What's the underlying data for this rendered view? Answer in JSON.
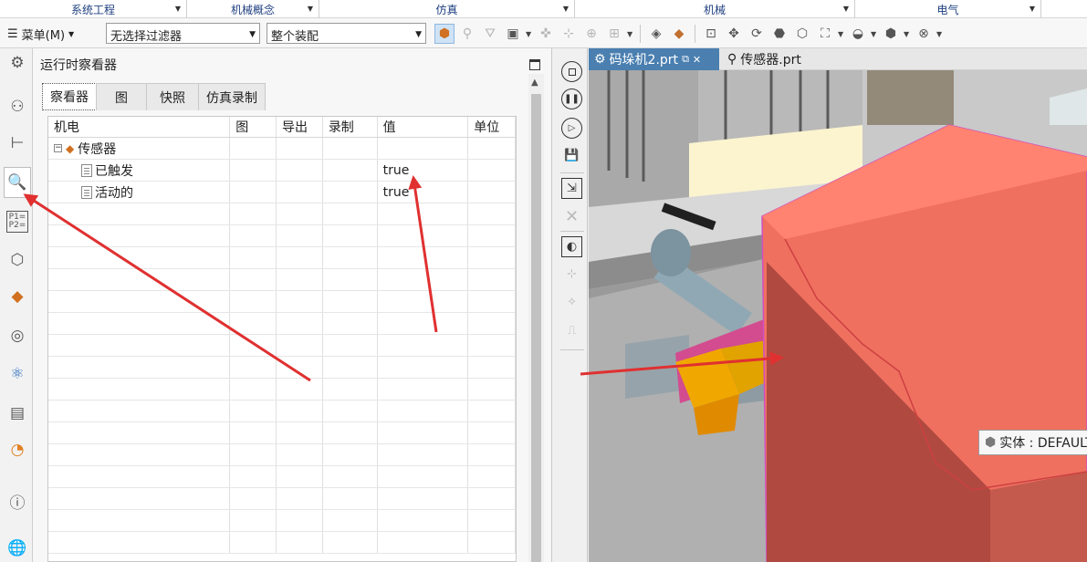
{
  "ribbon_groups": [
    {
      "label": "系统工程"
    },
    {
      "label": "机械概念"
    },
    {
      "label": "仿真"
    },
    {
      "label": "机械"
    },
    {
      "label": "电气"
    }
  ],
  "toolbar": {
    "menu_label": "菜单(M)",
    "selection_filter": "无选择过滤器",
    "assembly_scope": "整个装配"
  },
  "panel": {
    "title": "运行时察看器",
    "tabs": [
      "察看器",
      "图",
      "快照",
      "仿真录制"
    ],
    "columns": [
      "机电",
      "图",
      "导出",
      "录制",
      "值",
      "单位"
    ],
    "rows": [
      {
        "name": "传感器",
        "value": "",
        "level": 0
      },
      {
        "name": "已触发",
        "value": "true",
        "level": 1
      },
      {
        "name": "活动的",
        "value": "true",
        "level": 1
      }
    ]
  },
  "view_tabs": [
    {
      "label": "码垛机2.prt",
      "active": true
    },
    {
      "label": "传感器.prt",
      "active": false
    }
  ],
  "tooltip": {
    "text": "实体 : DEFAULT"
  },
  "colors": {
    "annotation_arrow": "#e03030",
    "box_body": "#f07060",
    "active_tab": "#4a7fb0",
    "sensor_yellow": "#f0a800"
  }
}
